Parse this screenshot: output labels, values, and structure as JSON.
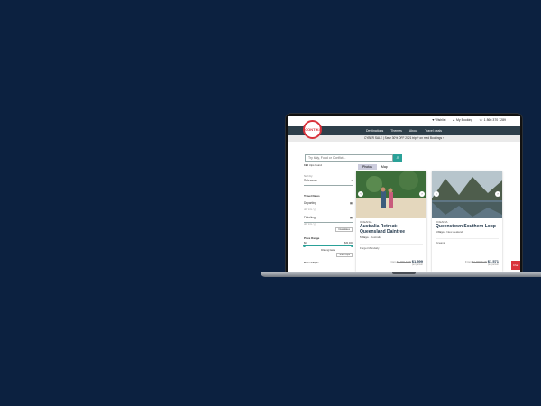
{
  "topbar": {
    "wishlist": "Wishlist",
    "my_booking": "My Booking",
    "phone": "1 866 370 7289",
    "logo": "CONTIKI"
  },
  "nav": [
    "Destinations",
    "Themes",
    "About",
    "Travel deals"
  ],
  "promo": "CYBER SALE | Save 30% OFF 2021 trips* on med Bookings ›",
  "search": {
    "placeholder": "Try italy, Food or Conflict..."
  },
  "sidebar": {
    "trips_count": "190",
    "trips_found": "trips found",
    "sort_label": "Sort by",
    "sort_value": "Relevance",
    "travel_dates": "Travel Dates",
    "departing": "Departing",
    "departing_hint": "dd / mm / yy",
    "finishing": "Finishing",
    "finishing_hint": "dd / mm / yy",
    "clear_dates": "Clear dates",
    "price_range": "Price Range",
    "price_min": "$0",
    "price_max": "$30,000",
    "filtering_hint": "Filtering faster",
    "show_trips": "Show trips",
    "travel_style": "Travel Style"
  },
  "view_tabs": {
    "list": "Photos",
    "map": "Map"
  },
  "cards": [
    {
      "region": "OCEANIA",
      "title": "Australia Retreat: Queensland Daintree",
      "days": "5 Days",
      "countries": "Australia",
      "tag": "Forget Mundaily",
      "price_from": "From",
      "price_old": "$1,999 AUD",
      "price_new": "$1,599",
      "price_unit": "per person"
    },
    {
      "region": "OCEANIA",
      "title": "Queenstown Southern Loop",
      "days": "6 Days",
      "countries": "New Zealand",
      "tag": "Oceanic",
      "price_from": "From",
      "price_old": "$1,999 AUD",
      "price_new": "$1,571",
      "price_unit": "per person"
    }
  ],
  "livechat": "Chat"
}
